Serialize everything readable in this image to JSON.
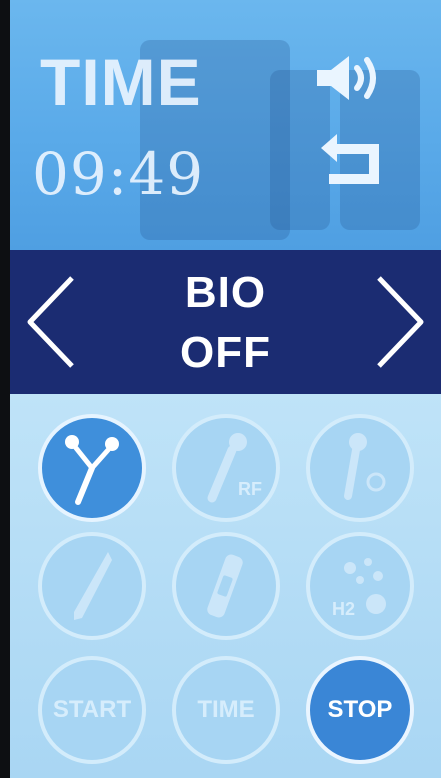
{
  "header": {
    "title": "TIME",
    "time_value": "09:49",
    "icons": [
      "speaker-icon",
      "back-return-icon"
    ]
  },
  "mode": {
    "name": "BIO",
    "state": "OFF"
  },
  "grid": {
    "rows": [
      [
        {
          "name": "bio-tool",
          "label": "",
          "active": true
        },
        {
          "name": "rf-tool",
          "label": "RF",
          "active": false
        },
        {
          "name": "cold-tool",
          "label": "",
          "active": false
        }
      ],
      [
        {
          "name": "pen-tool",
          "label": "",
          "active": false
        },
        {
          "name": "spray-tool",
          "label": "",
          "active": false
        },
        {
          "name": "hydrogen-tool",
          "label": "H2",
          "active": false
        }
      ]
    ],
    "start_label": "START",
    "time_label": "TIME",
    "stop_label": "STOP"
  },
  "colors": {
    "top_blue": "#5aaae9",
    "mode_bar": "#1b2c72",
    "active_button": "#3f8fdb",
    "panel": "#b7def6"
  }
}
